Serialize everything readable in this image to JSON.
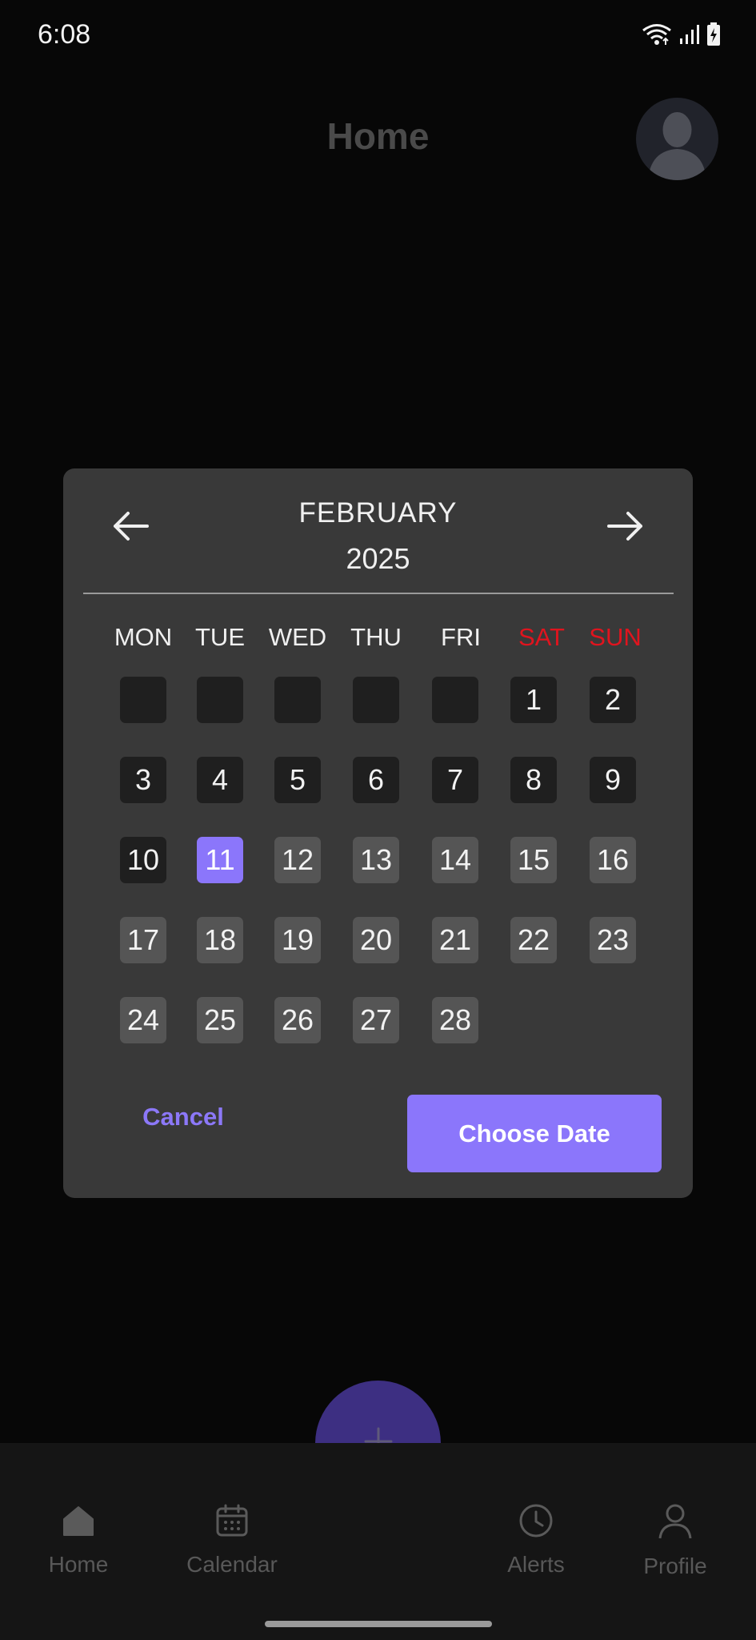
{
  "status_bar": {
    "time": "6:08",
    "icons": [
      "wifi-icon",
      "signal-icon",
      "battery-charging-icon"
    ]
  },
  "header": {
    "title": "Home",
    "avatar_icon": "person-silhouette-icon"
  },
  "date_picker": {
    "month": "FEBRUARY",
    "year": "2025",
    "prev_icon": "arrow-left-icon",
    "next_icon": "arrow-right-icon",
    "weekdays": [
      "MON",
      "TUE",
      "WED",
      "THU",
      "FRI",
      "SAT",
      "SUN"
    ],
    "weekend_color": "#e0141e",
    "leading_empty_cells": 5,
    "days": [
      "1",
      "2",
      "3",
      "4",
      "5",
      "6",
      "7",
      "8",
      "9",
      "10",
      "11",
      "12",
      "13",
      "14",
      "15",
      "16",
      "17",
      "18",
      "19",
      "20",
      "21",
      "22",
      "23",
      "24",
      "25",
      "26",
      "27",
      "28"
    ],
    "selected_day": "11",
    "cancel_label": "Cancel",
    "choose_label": "Choose Date",
    "accent_color": "#8b76fb"
  },
  "bottom_nav": {
    "items": [
      {
        "label": "Home",
        "icon": "home-icon"
      },
      {
        "label": "Calendar",
        "icon": "calendar-icon"
      },
      {
        "label": "Alerts",
        "icon": "clock-icon"
      },
      {
        "label": "Profile",
        "icon": "user-icon"
      }
    ],
    "fab_icon": "plus-icon"
  }
}
